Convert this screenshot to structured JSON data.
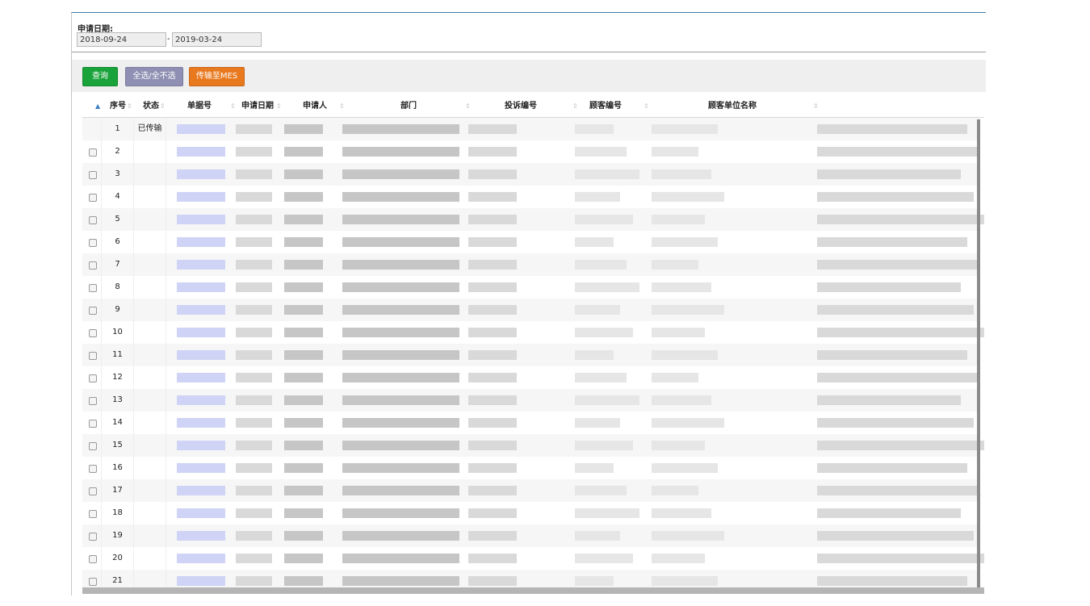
{
  "filter": {
    "date_label": "申请日期:",
    "date_from": "2018-09-24",
    "date_separator": "-",
    "date_to": "2019-03-24"
  },
  "toolbar": {
    "query_label": "查询",
    "select_all_label": "全选/全不选",
    "transfer_label": "传输至MES"
  },
  "table": {
    "columns": [
      "序号",
      "状态",
      "单据号",
      "申请日期",
      "申请人",
      "部门",
      "投诉编号",
      "顾客编号",
      "顾客单位名称"
    ],
    "rows": [
      {
        "no": "1",
        "status": "已传输"
      },
      {
        "no": "2",
        "status": ""
      },
      {
        "no": "3",
        "status": ""
      },
      {
        "no": "4",
        "status": ""
      },
      {
        "no": "5",
        "status": ""
      },
      {
        "no": "6",
        "status": ""
      },
      {
        "no": "7",
        "status": ""
      },
      {
        "no": "8",
        "status": ""
      },
      {
        "no": "9",
        "status": ""
      },
      {
        "no": "10",
        "status": ""
      },
      {
        "no": "11",
        "status": ""
      },
      {
        "no": "12",
        "status": ""
      },
      {
        "no": "13",
        "status": ""
      },
      {
        "no": "14",
        "status": ""
      },
      {
        "no": "15",
        "status": ""
      },
      {
        "no": "16",
        "status": ""
      },
      {
        "no": "17",
        "status": ""
      },
      {
        "no": "18",
        "status": ""
      },
      {
        "no": "19",
        "status": ""
      },
      {
        "no": "20",
        "status": ""
      },
      {
        "no": "21",
        "status": ""
      }
    ]
  },
  "colors": {
    "query_button": "#1ba33b",
    "select_button": "#8f8fb3",
    "transfer_button": "#e8791f",
    "frame_top_border": "#3f7fa6"
  }
}
